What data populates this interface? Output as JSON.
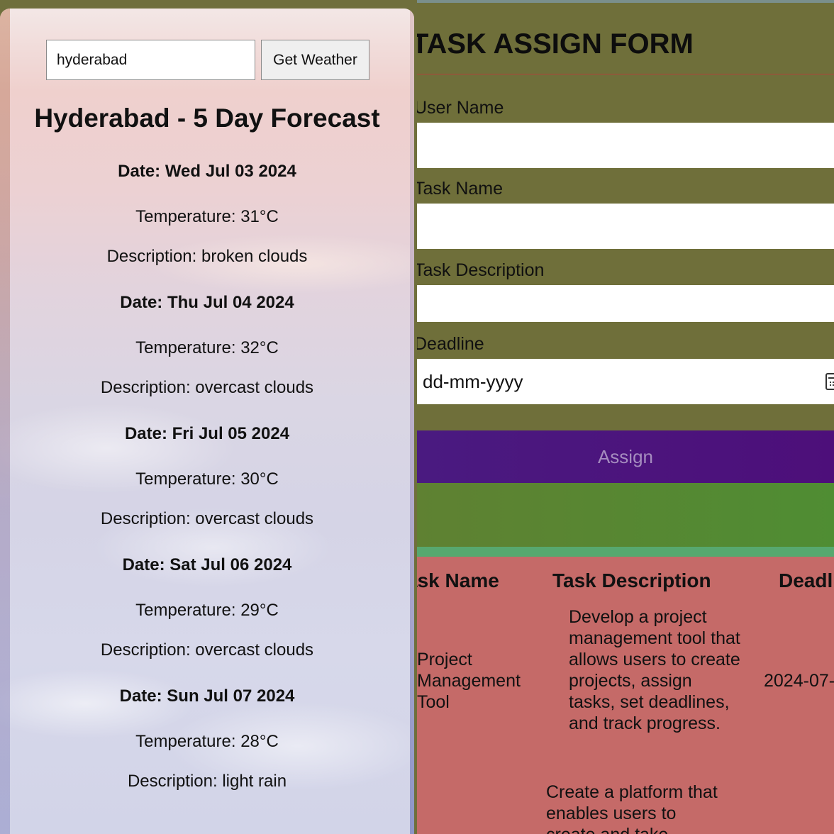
{
  "weather": {
    "city_value": "hyderabad",
    "button_label": "Get Weather",
    "title": "Hyderabad - 5 Day Forecast",
    "days": [
      {
        "date": "Date: Wed Jul 03 2024",
        "temperature": "Temperature: 31°C",
        "description": "Description: broken clouds"
      },
      {
        "date": "Date: Thu Jul 04 2024",
        "temperature": "Temperature: 32°C",
        "description": "Description: overcast clouds"
      },
      {
        "date": "Date: Fri Jul 05 2024",
        "temperature": "Temperature: 30°C",
        "description": "Description: overcast clouds"
      },
      {
        "date": "Date: Sat Jul 06 2024",
        "temperature": "Temperature: 29°C",
        "description": "Description: overcast clouds"
      },
      {
        "date": "Date: Sun Jul 07 2024",
        "temperature": "Temperature: 28°C",
        "description": "Description: light rain"
      }
    ]
  },
  "task_form": {
    "title": "TASK ASSIGN FORM",
    "labels": {
      "user_name": "User Name",
      "task_name": "Task Name",
      "task_description": "Task Description",
      "deadline": "Deadline"
    },
    "deadline_placeholder": "dd-mm-yyyy",
    "assign_label": "Assign",
    "table": {
      "headers": [
        "Task Name",
        "Task Description",
        "Deadline"
      ],
      "rows": [
        {
          "task_name": "Project Management Tool",
          "task_description": "Develop a project management tool that allows users to create projects, assign tasks, set deadlines, and track progress.",
          "deadline": "2024-07-"
        },
        {
          "task_name": "",
          "task_description": "Create a platform that enables users to create and take",
          "deadline": ""
        }
      ]
    }
  },
  "colors": {
    "form_background": "#6f6f3a",
    "assign_button": "#4a1a80",
    "table_background": "#c56a68",
    "green_band": "#5f8132"
  }
}
